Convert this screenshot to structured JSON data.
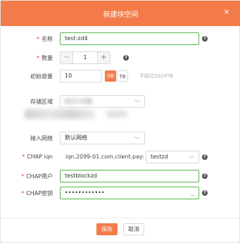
{
  "dialog": {
    "title": "新建块空间",
    "close_icon": "×"
  },
  "form": {
    "name": {
      "label": "名称",
      "value": "test-zd4"
    },
    "quantity": {
      "label": "数量",
      "value": "1",
      "minus": "−",
      "plus": "+"
    },
    "capacity": {
      "label": "初始容量",
      "value": "10",
      "unit_gb": "GB",
      "unit_tb": "TB",
      "hint": "不超过1024TB"
    },
    "storage_zone": {
      "label": "存储区域"
    },
    "access_network": {
      "label": "接入网络",
      "value": "默认网络"
    },
    "chap_iqn": {
      "label": "CHAP iqn",
      "prefix": "iqn.2099-01.com.client.pay:",
      "value": "testzd"
    },
    "chap_user": {
      "label": "CHAP用户",
      "value": "testblockzd"
    },
    "chap_secret": {
      "label": "CHAP密钥",
      "value": "••••••••••••"
    }
  },
  "required_mark": "*",
  "help_icon": "?",
  "buttons": {
    "save": "保存",
    "cancel": "取消"
  },
  "colors": {
    "accent": "#f37b4a",
    "focus": "#55b548",
    "required": "#e5393a"
  }
}
